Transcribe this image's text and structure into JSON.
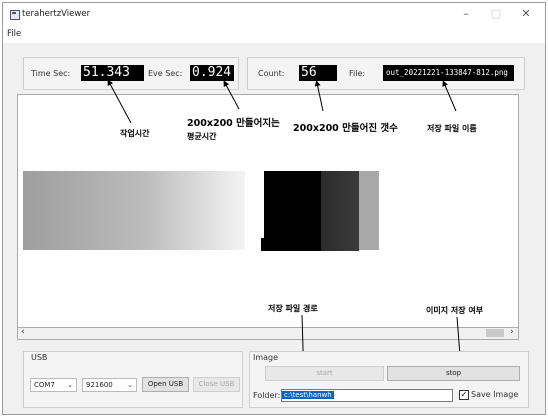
{
  "window": {
    "title": "terahertzViewer"
  },
  "menu": {
    "file": "File"
  },
  "timing": {
    "time_sec_label": "Time Sec:",
    "time_sec_value": "51.343",
    "eve_sec_label": "Eve Sec:",
    "eve_sec_value": "0.924"
  },
  "counter": {
    "count_label": "Count:",
    "count_value": "56",
    "file_label": "File:",
    "file_value": "out_20221221-133847-812.png"
  },
  "annotations": {
    "work_time": "작업시간",
    "avg_time_line1": "200x200 만들어지는",
    "avg_time_line2": "평균시간",
    "count_made": "200x200 만들어진 갯수",
    "save_file_name": "저장 파일 이름",
    "save_path": "저장 파일 경로",
    "save_image_flag": "이미지 저장 여부"
  },
  "usb": {
    "group_label": "USB",
    "port": "COM7",
    "baud": "921600",
    "open_label": "Open USB",
    "close_label": "Close USB"
  },
  "image": {
    "group_label": "Image",
    "start_label": "start",
    "stop_label": "stop",
    "folder_label": "Folder:",
    "folder_value": "c:\\test\\hanwh",
    "save_image_label": "Save Image",
    "save_image_checked": true
  },
  "colors": {
    "display_bg": "#000000",
    "display_fg": "#ffffff",
    "selection": "#0a64c8"
  }
}
